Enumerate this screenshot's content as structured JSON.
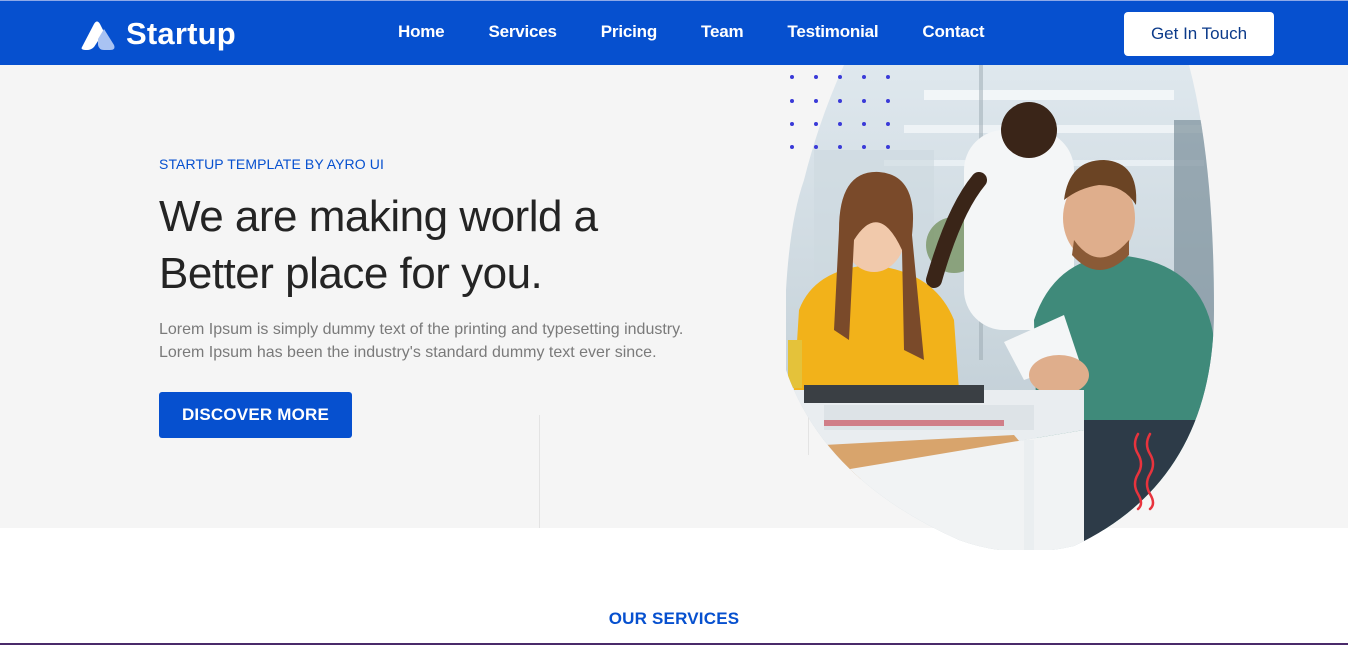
{
  "brand": {
    "name": "Startup",
    "icon": "startup-logo-icon"
  },
  "nav": {
    "items": [
      {
        "label": "Home"
      },
      {
        "label": "Services"
      },
      {
        "label": "Pricing"
      },
      {
        "label": "Team"
      },
      {
        "label": "Testimonial"
      },
      {
        "label": "Contact"
      }
    ],
    "cta_label": "Get In Touch"
  },
  "hero": {
    "eyebrow": "STARTUP TEMPLATE BY AYRO UI",
    "headline_line1": "We are making world a",
    "headline_line2": "Better place for you.",
    "lead_line1": "Lorem Ipsum is simply dummy text of the printing and typesetting industry.",
    "lead_line2": "Lorem Ipsum has been the industry's standard dummy text ever since.",
    "button_label": "DISCOVER MORE",
    "image": "team-office-photo"
  },
  "services": {
    "heading": "OUR SERVICES"
  },
  "colors": {
    "primary": "#0650cf",
    "hero_bg": "#f5f5f5",
    "heading_text": "#242424",
    "body_text": "#7a7a7a",
    "accent_dots": "#3a3ad8",
    "accent_wave": "#e8333d"
  }
}
